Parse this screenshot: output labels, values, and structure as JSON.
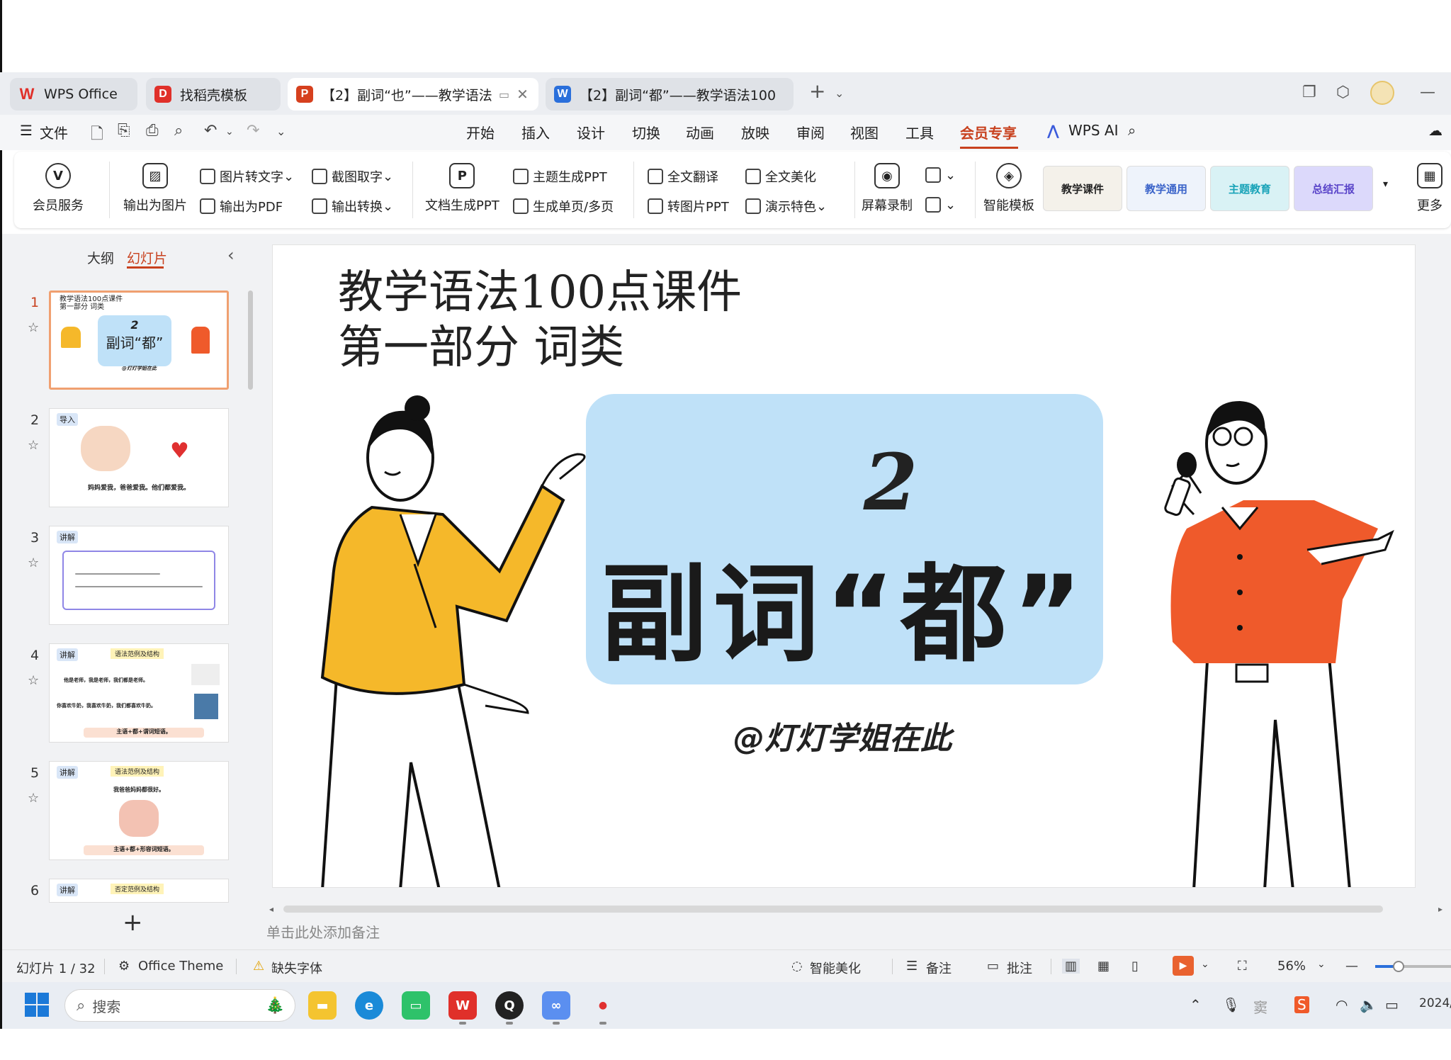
{
  "tabs": [
    {
      "label": "WPS Office",
      "logo": "W",
      "logo_color": "#e0302a"
    },
    {
      "label": "找稻壳模板",
      "logo": "D",
      "logo_color": "#e0302a"
    },
    {
      "label": "【2】副词“也”——教学语法",
      "logo": "P",
      "logo_color": "#d6401e"
    },
    {
      "label": "【2】副词“都”——教学语法100",
      "logo": "W",
      "logo_color": "#2a6fdb"
    }
  ],
  "menu": {
    "file": "文件",
    "items": [
      "开始",
      "插入",
      "设计",
      "切换",
      "动画",
      "放映",
      "审阅",
      "视图",
      "工具",
      "会员专享"
    ],
    "wps_ai": "WPS AI"
  },
  "ribbon": {
    "member_service": "会员服务",
    "export_image": "输出为图片",
    "image_to_text": "图片转文字",
    "export_pdf": "输出为PDF",
    "screenshot_text": "截图取字",
    "export_convert": "输出转换",
    "doc_to_ppt": "文档生成PPT",
    "theme_ppt": "主题生成PPT",
    "single_multi": "生成单页/多页",
    "full_translate": "全文翻译",
    "image_ppt": "转图片PPT",
    "full_beautify": "全文美化",
    "presentation_feature": "演示特色",
    "screen_record": "屏幕录制",
    "smart_template": "智能模板",
    "more": "更多",
    "templates": [
      "教学课件",
      "教学通用",
      "主题教育",
      "总结汇报"
    ]
  },
  "left_panel": {
    "tab_outline": "大纲",
    "tab_slides": "幻灯片",
    "slides": [
      {
        "num": "1",
        "title": "教学语法100点课件\n第一部分 词类",
        "number": "2",
        "heading": "副词“都”",
        "author": "@灯灯学姐在此"
      },
      {
        "num": "2",
        "tag": "导入",
        "text": "妈妈爱我，爸爸爱我。他们都爱我。"
      },
      {
        "num": "3",
        "tag": "讲解"
      },
      {
        "num": "4",
        "tag": "讲解",
        "subtitle": "语法范例及结构",
        "line1": "他是老师，我是老师，我们都是老师。",
        "line2": "你喜欢牛奶，我喜欢牛奶，我们都喜欢牛奶。",
        "bottom": "主语+都+谓词短语。"
      },
      {
        "num": "5",
        "tag": "讲解",
        "subtitle": "语法范例及结构",
        "line1": "我爸爸妈妈都很好。",
        "bottom": "主语+都+形容词短语。"
      },
      {
        "num": "6",
        "tag": "讲解",
        "subtitle": "否定范例及结构"
      }
    ]
  },
  "slide": {
    "title_line1": "教学语法100点课件",
    "title_line2": "第一部分 词类",
    "number": "2",
    "heading": "副词“都”",
    "author": "@灯灯学姐在此"
  },
  "notes_placeholder": "单击此处添加备注",
  "status": {
    "slide_counter": "幻灯片 1 / 32",
    "theme": "Office Theme",
    "missing_font": "缺失字体",
    "smart_beautify": "智能美化",
    "notes": "备注",
    "comments": "批注",
    "zoom": "56%",
    "zoom_level": 0.3
  },
  "taskbar": {
    "search_placeholder": "搜索",
    "clock": "2024/"
  },
  "colors": {
    "accent": "#c8411e",
    "slide_box": "#bfe1f8",
    "woman_jacket": "#f5b82a",
    "man_shirt": "#ef5a2b"
  }
}
